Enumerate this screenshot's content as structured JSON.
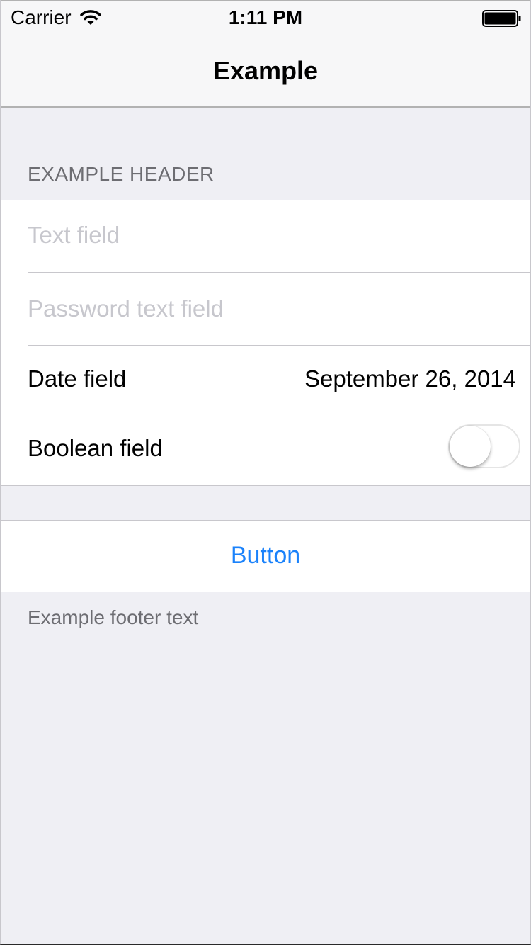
{
  "status_bar": {
    "carrier": "Carrier",
    "time": "1:11 PM"
  },
  "navbar": {
    "title": "Example"
  },
  "section": {
    "header": "EXAMPLE HEADER",
    "text_field_placeholder": "Text field",
    "password_field_placeholder": "Password text field",
    "date_label": "Date field",
    "date_value": "September 26, 2014",
    "boolean_label": "Boolean field",
    "boolean_on": false
  },
  "action": {
    "button_label": "Button"
  },
  "footer": {
    "text": "Example footer text"
  },
  "colors": {
    "tint": "#1a82fb",
    "background": "#efeff4",
    "separator": "#c8c7cc",
    "placeholder": "#c7c7cd",
    "section_text": "#6d6d72"
  },
  "icons": [
    "wifi-icon",
    "battery-icon"
  ]
}
